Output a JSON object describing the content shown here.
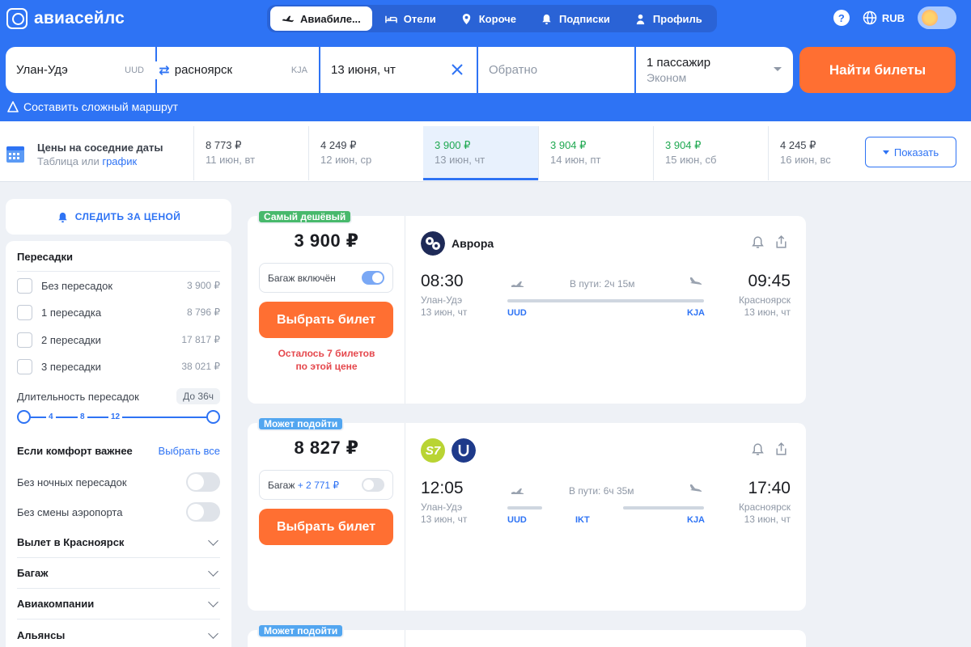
{
  "header": {
    "logo_text": "авиасейлс",
    "nav": [
      {
        "label": "Авиабиле..."
      },
      {
        "label": "Отели"
      },
      {
        "label": "Короче"
      },
      {
        "label": "Подписки"
      },
      {
        "label": "Профиль"
      }
    ],
    "help": "?",
    "currency": "RUB"
  },
  "search": {
    "origin": "Улан-Удэ",
    "origin_iata": "UUD",
    "destination": "Красноярск",
    "destination_iata": "KJA",
    "date": "13 июня, чт",
    "return_placeholder": "Обратно",
    "passengers": "1 пассажир",
    "cabin": "Эконом",
    "find_button": "Найти билеты",
    "complex_route": "Составить сложный маршрут"
  },
  "dates": {
    "title": "Цены на соседние даты",
    "sub_table": "Таблица",
    "sub_or": " или ",
    "sub_chart": "график",
    "cells": [
      {
        "price": "8 773 ₽",
        "day": "11 июн, вт"
      },
      {
        "price": "4 249 ₽",
        "day": "12 июн, ср"
      },
      {
        "price": "3 900 ₽",
        "day": "13 июн, чт"
      },
      {
        "price": "3 904 ₽",
        "day": "14 июн, пт"
      },
      {
        "price": "3 904 ₽",
        "day": "15 июн, сб"
      },
      {
        "price": "4 245 ₽",
        "day": "16 июн, вс"
      }
    ],
    "show_button": "Показать"
  },
  "sidebar": {
    "track_price": "СЛЕДИТЬ ЗА ЦЕНОЙ",
    "stops_title": "Пересадки",
    "stops": [
      {
        "label": "Без пересадок",
        "price": "3 900 ₽"
      },
      {
        "label": "1 пересадка",
        "price": "8 796 ₽"
      },
      {
        "label": "2 пересадки",
        "price": "17 817 ₽"
      },
      {
        "label": "3 пересадки",
        "price": "38 021 ₽"
      }
    ],
    "duration_title": "Длительность пересадок",
    "duration_badge": "До 36ч",
    "slider_ticks": [
      "4",
      "8",
      "12"
    ],
    "comfort_title": "Если комфорт важнее",
    "comfort_select_all": "Выбрать все",
    "no_night": "Без ночных пересадок",
    "no_airport_change": "Без смены аэропорта",
    "sections": [
      "Вылет в Красноярск",
      "Багаж",
      "Авиакомпании",
      "Альянсы"
    ]
  },
  "tickets": [
    {
      "tag": "Самый дешёвый",
      "price": "3 900 ₽",
      "baggage_label": "Багаж включён",
      "baggage_on": true,
      "choose_button": "Выбрать билет",
      "note_line1": "Осталось 7 билетов",
      "note_line2": "по этой цене",
      "airline": "Аврора",
      "dep_time": "08:30",
      "dep_city": "Улан-Удэ",
      "dep_date": "13 июн, чт",
      "arr_time": "09:45",
      "arr_city": "Красноярск",
      "arr_date": "13 июн, чт",
      "duration": "В пути: 2ч 15м",
      "from_iata": "UUD",
      "to_iata": "KJA"
    },
    {
      "tag": "Может подойти",
      "price": "8 827 ₽",
      "baggage_label": "Багаж",
      "baggage_extra": "+ 2 771 ₽",
      "baggage_on": false,
      "choose_button": "Выбрать билет",
      "airline_logo1_text": "S7",
      "dep_time": "12:05",
      "dep_city": "Улан-Удэ",
      "dep_date": "13 июн, чт",
      "arr_time": "17:40",
      "arr_city": "Красноярск",
      "arr_date": "13 июн, чт",
      "duration": "В пути: 6ч 35м",
      "from_iata": "UUD",
      "via_iata": "IKT",
      "to_iata": "KJA"
    },
    {
      "tag": "Может подойти"
    }
  ]
}
